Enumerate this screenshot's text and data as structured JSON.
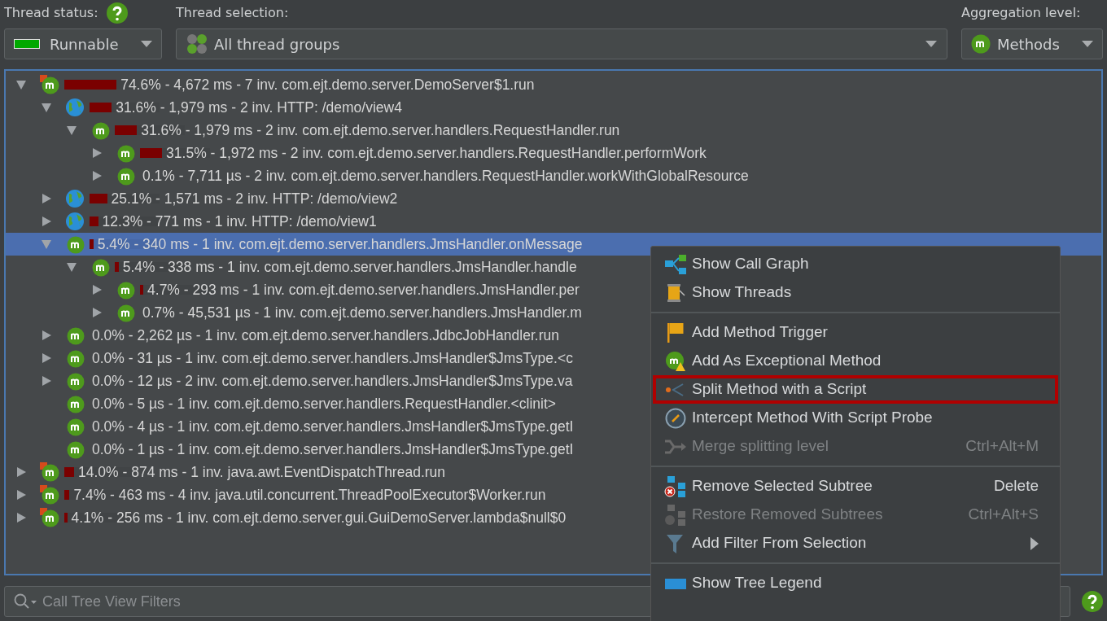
{
  "toolbar": {
    "thread_status": {
      "label": "Thread status:",
      "value": "Runnable",
      "color": "#00a800"
    },
    "thread_selection": {
      "label": "Thread selection:",
      "value": "All thread groups"
    },
    "aggregation": {
      "label": "Aggregation level:",
      "value": "Methods"
    }
  },
  "tree": [
    {
      "kind": "thread",
      "text": "74.6% - 4,672 ms - 7 inv. com.ejt.demo.server.DemoServer$1.run",
      "level": 0.746,
      "has_children": true,
      "expanded": true,
      "selected": false,
      "children": [
        {
          "kind": "http",
          "text": "31.6% - 1,979 ms - 2 inv. HTTP: /demo/view4",
          "level": 0.316,
          "has_children": true,
          "expanded": true,
          "selected": false,
          "children": [
            {
              "kind": "method",
              "text": "31.6% - 1,979 ms - 2 inv. com.ejt.demo.server.handlers.RequestHandler.run",
              "level": 0.316,
              "has_children": true,
              "expanded": true,
              "selected": false,
              "children": [
                {
                  "kind": "method",
                  "text": "31.5% - 1,972 ms - 2 inv. com.ejt.demo.server.handlers.RequestHandler.performWork",
                  "level": 0.315,
                  "has_children": true,
                  "expanded": false,
                  "selected": false
                },
                {
                  "kind": "method",
                  "text": "0.1% - 7,711 µs - 2 inv. com.ejt.demo.server.handlers.RequestHandler.workWithGlobalResource",
                  "has_children": true,
                  "expanded": false,
                  "selected": false
                }
              ]
            }
          ]
        },
        {
          "kind": "http",
          "text": "25.1% - 1,571 ms - 2 inv. HTTP: /demo/view2",
          "level": 0.251,
          "has_children": true,
          "expanded": false,
          "selected": false
        },
        {
          "kind": "http",
          "text": "12.3% - 771 ms - 1 inv. HTTP: /demo/view1",
          "level": 0.123,
          "has_children": true,
          "expanded": false,
          "selected": false
        },
        {
          "kind": "method",
          "text": "5.4% - 340 ms - 1 inv. com.ejt.demo.server.handlers.JmsHandler.onMessage",
          "level": 0.054,
          "has_children": true,
          "expanded": true,
          "selected": true,
          "children": [
            {
              "kind": "method",
              "text": "5.4% - 338 ms - 1 inv. com.ejt.demo.server.handlers.JmsHandler.handle",
              "level": 0.054,
              "has_children": true,
              "expanded": true,
              "selected": false,
              "children": [
                {
                  "kind": "method",
                  "text": "4.7% - 293 ms - 1 inv. com.ejt.demo.server.handlers.JmsHandler.per",
                  "level": 0.047,
                  "has_children": true,
                  "expanded": false,
                  "selected": false
                },
                {
                  "kind": "method",
                  "text": "0.7% - 45,531 µs - 1 inv. com.ejt.demo.server.handlers.JmsHandler.m",
                  "has_children": true,
                  "expanded": false,
                  "selected": false
                }
              ]
            }
          ]
        },
        {
          "kind": "method",
          "text": "0.0% - 2,262 µs - 1 inv. com.ejt.demo.server.handlers.JdbcJobHandler.run",
          "has_children": true,
          "expanded": false,
          "selected": false
        },
        {
          "kind": "method",
          "text": "0.0% - 31 µs - 1 inv. com.ejt.demo.server.handlers.JmsHandler$JmsType.<c",
          "has_children": true,
          "expanded": false,
          "selected": false
        },
        {
          "kind": "method",
          "text": "0.0% - 12 µs - 2 inv. com.ejt.demo.server.handlers.JmsHandler$JmsType.va",
          "has_children": true,
          "expanded": false,
          "selected": false
        },
        {
          "kind": "method",
          "text": "0.0% - 5 µs - 1 inv. com.ejt.demo.server.handlers.RequestHandler.<clinit>",
          "has_children": false,
          "selected": false
        },
        {
          "kind": "method",
          "text": "0.0% - 4 µs - 1 inv. com.ejt.demo.server.handlers.JmsHandler$JmsType.getI",
          "has_children": false,
          "selected": false
        },
        {
          "kind": "method",
          "text": "0.0% - 1 µs - 1 inv. com.ejt.demo.server.handlers.JmsHandler$JmsType.getI",
          "has_children": false,
          "selected": false
        }
      ]
    },
    {
      "kind": "thread",
      "text": "14.0% - 874 ms - 1 inv. java.awt.EventDispatchThread.run",
      "level": 0.14,
      "has_children": true,
      "expanded": false,
      "selected": false
    },
    {
      "kind": "thread",
      "text": "7.4% - 463 ms - 4 inv. java.util.concurrent.ThreadPoolExecutor$Worker.run",
      "level": 0.074,
      "has_children": true,
      "expanded": false,
      "selected": false
    },
    {
      "kind": "thread",
      "text": "4.1% - 256 ms - 1 inv. com.ejt.demo.server.gui.GuiDemoServer.lambda$null$0",
      "level": 0.041,
      "has_children": true,
      "expanded": false,
      "selected": false
    }
  ],
  "context_menu": [
    {
      "kind": "item",
      "label": "Show Call Graph",
      "disabled": false,
      "highlighted": false,
      "submenu": false
    },
    {
      "kind": "item",
      "label": "Show Threads",
      "disabled": false,
      "highlighted": false,
      "submenu": false
    },
    {
      "kind": "separator"
    },
    {
      "kind": "item",
      "label": "Add Method Trigger",
      "disabled": false,
      "highlighted": false,
      "submenu": false
    },
    {
      "kind": "item",
      "label": "Add As Exceptional Method",
      "disabled": false,
      "highlighted": false,
      "submenu": false
    },
    {
      "kind": "item",
      "label": "Split Method with a Script",
      "disabled": false,
      "highlighted": true,
      "submenu": false
    },
    {
      "kind": "item",
      "label": "Intercept Method With Script Probe",
      "disabled": false,
      "highlighted": false,
      "submenu": false
    },
    {
      "kind": "item",
      "label": "Merge splitting level",
      "shortcut": "Ctrl+Alt+M",
      "disabled": true,
      "highlighted": false,
      "submenu": false
    },
    {
      "kind": "separator"
    },
    {
      "kind": "item",
      "label": "Remove Selected Subtree",
      "shortcut": "Delete",
      "disabled": false,
      "highlighted": false,
      "submenu": false
    },
    {
      "kind": "item",
      "label": "Restore Removed Subtrees",
      "shortcut": "Ctrl+Alt+S",
      "disabled": true,
      "highlighted": false,
      "submenu": false
    },
    {
      "kind": "item",
      "label": "Add Filter From Selection",
      "disabled": false,
      "highlighted": false,
      "submenu": true
    },
    {
      "kind": "separator"
    },
    {
      "kind": "item",
      "label": "Show Tree Legend",
      "disabled": false,
      "highlighted": false,
      "submenu": false
    }
  ],
  "filter": {
    "placeholder": "Call Tree View Filters"
  }
}
